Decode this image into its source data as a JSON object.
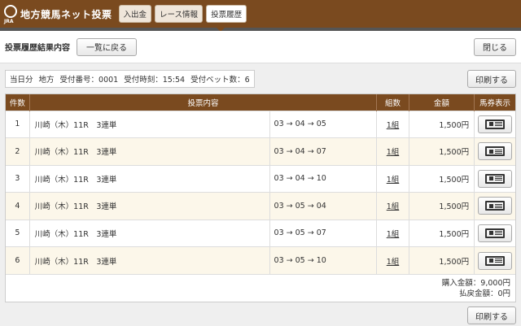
{
  "header": {
    "logo_text": "地方競馬ネット投票",
    "logo_sub": "JRA",
    "nav": [
      {
        "label": "入出金"
      },
      {
        "label": "レース情報"
      },
      {
        "label": "投票履歴"
      }
    ]
  },
  "titlebar": {
    "title": "投票履歴結果内容",
    "back_label": "一覧に戻る",
    "close_label": "閉じる"
  },
  "info": {
    "day": "当日分",
    "category": "地方",
    "receipt_no": "受付番号：0001",
    "receipt_time": "受付時刻：15:54",
    "bet_count": "受付ベット数：6",
    "print_label": "印刷する"
  },
  "table": {
    "headers": {
      "num": "件数",
      "detail": "投票内容",
      "sets": "組数",
      "amount": "金額",
      "ticket": "馬券表示"
    },
    "rows": [
      {
        "num": "1",
        "detail": "川崎（木）11R　3連単",
        "combo": "03 → 04 → 05",
        "sets": "1組",
        "amount": "1,500円"
      },
      {
        "num": "2",
        "detail": "川崎（木）11R　3連単",
        "combo": "03 → 04 → 07",
        "sets": "1組",
        "amount": "1,500円"
      },
      {
        "num": "3",
        "detail": "川崎（木）11R　3連単",
        "combo": "03 → 04 → 10",
        "sets": "1組",
        "amount": "1,500円"
      },
      {
        "num": "4",
        "detail": "川崎（木）11R　3連単",
        "combo": "03 → 05 → 04",
        "sets": "1組",
        "amount": "1,500円"
      },
      {
        "num": "5",
        "detail": "川崎（木）11R　3連単",
        "combo": "03 → 05 → 07",
        "sets": "1組",
        "amount": "1,500円"
      },
      {
        "num": "6",
        "detail": "川崎（木）11R　3連単",
        "combo": "03 → 05 → 10",
        "sets": "1組",
        "amount": "1,500円"
      }
    ]
  },
  "totals": {
    "purchase": "購入金額：9,000円",
    "refund": "払戻金額：0円"
  },
  "bottom": {
    "print_label": "印刷する"
  },
  "colors": {
    "header_brown": "#7a4a1f",
    "row_alt": "#fcf7ea"
  },
  "icons": {
    "logo": "jra-logo-icon",
    "ticket": "ticket-icon"
  }
}
